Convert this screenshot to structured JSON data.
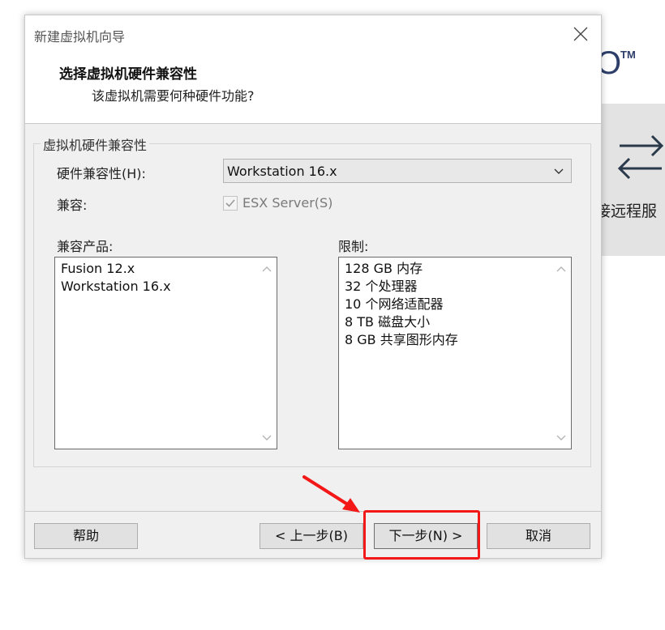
{
  "background": {
    "logo_tm": "TM",
    "panel_label": "接远程服",
    "panel_icon": "swap-arrows-icon"
  },
  "dialog": {
    "window_title": "新建虚拟机向导",
    "header_title": "选择虚拟机硬件兼容性",
    "header_subtitle": "该虚拟机需要何种硬件功能?",
    "group_title": "虚拟机硬件兼容性",
    "hw_compat_label": "硬件兼容性(H):",
    "hw_compat_value": "Workstation 16.x",
    "compat_label": "兼容:",
    "esx_checkbox_label": "ESX Server(S)",
    "esx_checked": true,
    "products_label": "兼容产品:",
    "products": [
      "Fusion 12.x",
      "Workstation 16.x"
    ],
    "limits_label": "限制:",
    "limits": [
      "128 GB 内存",
      "32 个处理器",
      "10 个网络适配器",
      "8 TB 磁盘大小",
      "8 GB 共享图形内存"
    ],
    "buttons": {
      "help": "帮助",
      "back": "< 上一步(B)",
      "next": "下一步(N) >",
      "cancel": "取消"
    }
  },
  "colors": {
    "highlight": "#f41717",
    "dialog_bg": "#f0f0f0",
    "button_bg": "#e1e1e1"
  }
}
